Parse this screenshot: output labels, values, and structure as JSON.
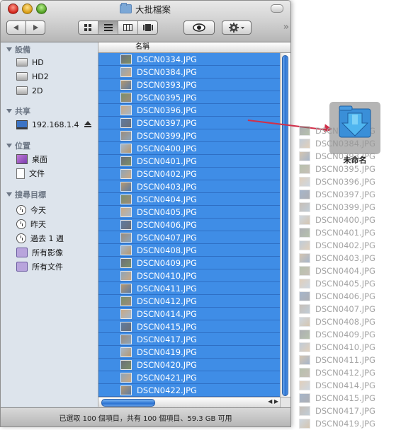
{
  "window": {
    "title": "大批檔案",
    "status_text": "已選取 100 個項目，共有 100 個項目、59.3 GB 可用"
  },
  "toolbar": {
    "back_icon": "left-arrow-icon",
    "forward_icon": "right-arrow-icon",
    "view_modes": [
      "icon-view",
      "list-view",
      "column-view",
      "coverflow-view"
    ],
    "active_view": "list-view",
    "quicklook_icon": "eye-icon",
    "action_icon": "gear-icon",
    "overflow_glyph": "»"
  },
  "sidebar": {
    "sections": [
      {
        "title": "設備",
        "items": [
          {
            "label": "HD",
            "icon": "disk-icon"
          },
          {
            "label": "HD2",
            "icon": "disk-icon"
          },
          {
            "label": "2D",
            "icon": "disk-icon"
          }
        ]
      },
      {
        "title": "共享",
        "items": [
          {
            "label": "192.168.1.4",
            "icon": "computer-icon",
            "eject": true
          }
        ]
      },
      {
        "title": "位置",
        "items": [
          {
            "label": "桌面",
            "icon": "desktop-icon"
          },
          {
            "label": "文件",
            "icon": "document-icon"
          }
        ]
      },
      {
        "title": "搜尋目標",
        "items": [
          {
            "label": "今天",
            "icon": "clock-icon"
          },
          {
            "label": "昨天",
            "icon": "clock-icon"
          },
          {
            "label": "過去 1 週",
            "icon": "clock-icon"
          },
          {
            "label": "所有影像",
            "icon": "smart-folder-icon"
          },
          {
            "label": "所有文件",
            "icon": "smart-folder-icon"
          }
        ]
      }
    ]
  },
  "list": {
    "column_header": "名稱",
    "files": [
      "DSCN0334.JPG",
      "DSCN0384.JPG",
      "DSCN0393.JPG",
      "DSCN0395.JPG",
      "DSCN0396.JPG",
      "DSCN0397.JPG",
      "DSCN0399.JPG",
      "DSCN0400.JPG",
      "DSCN0401.JPG",
      "DSCN0402.JPG",
      "DSCN0403.JPG",
      "DSCN0404.JPG",
      "DSCN0405.JPG",
      "DSCN0406.JPG",
      "DSCN0407.JPG",
      "DSCN0408.JPG",
      "DSCN0409.JPG",
      "DSCN0410.JPG",
      "DSCN0411.JPG",
      "DSCN0412.JPG",
      "DSCN0414.JPG",
      "DSCN0415.JPG",
      "DSCN0417.JPG",
      "DSCN0419.JPG",
      "DSCN0420.JPG",
      "DSCN0421.JPG",
      "DSCN0422.JPG"
    ]
  },
  "drag": {
    "target_label": "未命名",
    "files": [
      "DSCN0334.JPG",
      "DSCN0384.JPG",
      "DSCN0393.JPG",
      "DSCN0395.JPG",
      "DSCN0396.JPG",
      "DSCN0397.JPG",
      "DSCN0399.JPG",
      "DSCN0400.JPG",
      "DSCN0401.JPG",
      "DSCN0402.JPG",
      "DSCN0403.JPG",
      "DSCN0404.JPG",
      "DSCN0405.JPG",
      "DSCN0406.JPG",
      "DSCN0407.JPG",
      "DSCN0408.JPG",
      "DSCN0409.JPG",
      "DSCN0410.JPG",
      "DSCN0411.JPG",
      "DSCN0412.JPG",
      "DSCN0414.JPG",
      "DSCN0415.JPG",
      "DSCN0417.JPG",
      "DSCN0419.JPG"
    ]
  },
  "colors": {
    "selection": "#3f8de6",
    "arrow": "#d0304a",
    "drop_folder": "#3a8fd8"
  }
}
